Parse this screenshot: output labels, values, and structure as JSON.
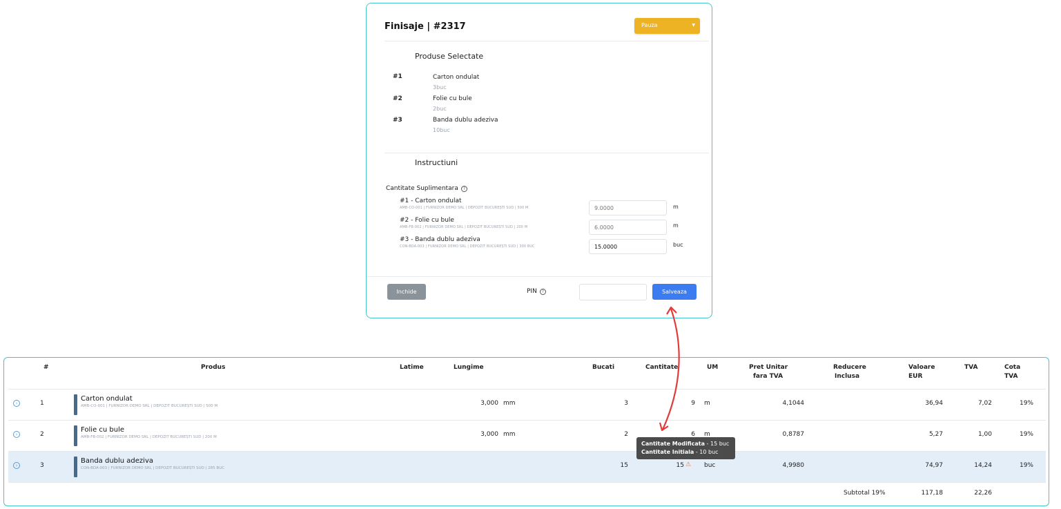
{
  "modal": {
    "title": "Finisaje | #2317",
    "status": "Pauza",
    "selected_products_title": "Produse Selectate",
    "products": [
      {
        "num": "#1",
        "name": "Carton ondulat",
        "qty": "3buc"
      },
      {
        "num": "#2",
        "name": "Folie cu bule",
        "qty": "2buc"
      },
      {
        "num": "#3",
        "name": "Banda dublu adeziva",
        "qty": "10buc"
      }
    ],
    "instructions_title": "Instructiuni",
    "extra_label": "Cantitate Suplimentara",
    "extra": [
      {
        "name": "#1 - Carton ondulat",
        "meta": "AMB-CO-001 | FURNIZOR DEMO SRL | DEPOZIT BUCUREȘTI SUD | 500 M",
        "value": "9.0000",
        "unit": "m"
      },
      {
        "name": "#2 - Folie cu bule",
        "meta": "AMB-FB-002 | FURNIZOR DEMO SRL | DEPOZIT BUCUREȘTI SUD | 200 M",
        "value": "6.0000",
        "unit": "m"
      },
      {
        "name": "#3 - Banda dublu adeziva",
        "meta": "CON-BDA-003 | FURNIZOR DEMO SRL | DEPOZIT BUCUREȘTI SUD | 300 BUC",
        "value": "15.0000",
        "unit": "buc"
      }
    ],
    "close_label": "Inchide",
    "pin_label": "PIN",
    "save_label": "Salveaza"
  },
  "table": {
    "headers": {
      "num": "#",
      "product": "Produs",
      "width": "Latime",
      "length": "Lungime",
      "pieces": "Bucati",
      "quantity": "Cantitate",
      "um": "UM",
      "unit_price_1": "Pret Unitar",
      "unit_price_2": "fara TVA",
      "discount_1": "Reducere",
      "discount_2": "Inclusa",
      "value_1": "Valoare",
      "value_2": "EUR",
      "vat": "TVA",
      "vat_rate_1": "Cota",
      "vat_rate_2": "TVA"
    },
    "rows": [
      {
        "num": "1",
        "name": "Carton ondulat",
        "meta": "AMB-CO-001 | FURNIZOR DEMO SRL | DEPOZIT BUCUREȘTI SUD | 500 M",
        "length": "3,000",
        "length_unit": "mm",
        "pieces": "3",
        "quantity": "9",
        "um": "m",
        "unit_price": "4,1044",
        "value": "36,94",
        "vat": "7,02",
        "vat_rate": "19%"
      },
      {
        "num": "2",
        "name": "Folie cu bule",
        "meta": "AMB-FB-002 | FURNIZOR DEMO SRL | DEPOZIT BUCUREȘTI SUD | 200 M",
        "length": "3,000",
        "length_unit": "mm",
        "pieces": "2",
        "quantity": "6",
        "um": "m",
        "unit_price": "0,8787",
        "value": "5,27",
        "vat": "1,00",
        "vat_rate": "19%"
      },
      {
        "num": "3",
        "name": "Banda dublu adeziva",
        "meta": "CON-BDA-003 | FURNIZOR DEMO SRL | DEPOZIT BUCUREȘTI SUD | 285 BUC",
        "length": "",
        "length_unit": "",
        "pieces": "15",
        "quantity": "15",
        "um": "buc",
        "unit_price": "4,9980",
        "value": "74,97",
        "vat": "14,24",
        "vat_rate": "19%"
      }
    ],
    "subtotal_label": "Subtotal 19%",
    "subtotal_value": "117,18",
    "subtotal_vat": "22,26"
  },
  "tooltip": {
    "modified_label": "Cantitate Modificata",
    "modified_value": " - 15 buc",
    "initial_label": "Cantitate Initiala",
    "initial_value": " - 10 buc"
  },
  "colors": {
    "accent_border": "#46c4c9",
    "status": "#edb324",
    "save": "#3b7cf0",
    "arrow": "#e03c3c",
    "highlight_row": "#e3eef9"
  }
}
